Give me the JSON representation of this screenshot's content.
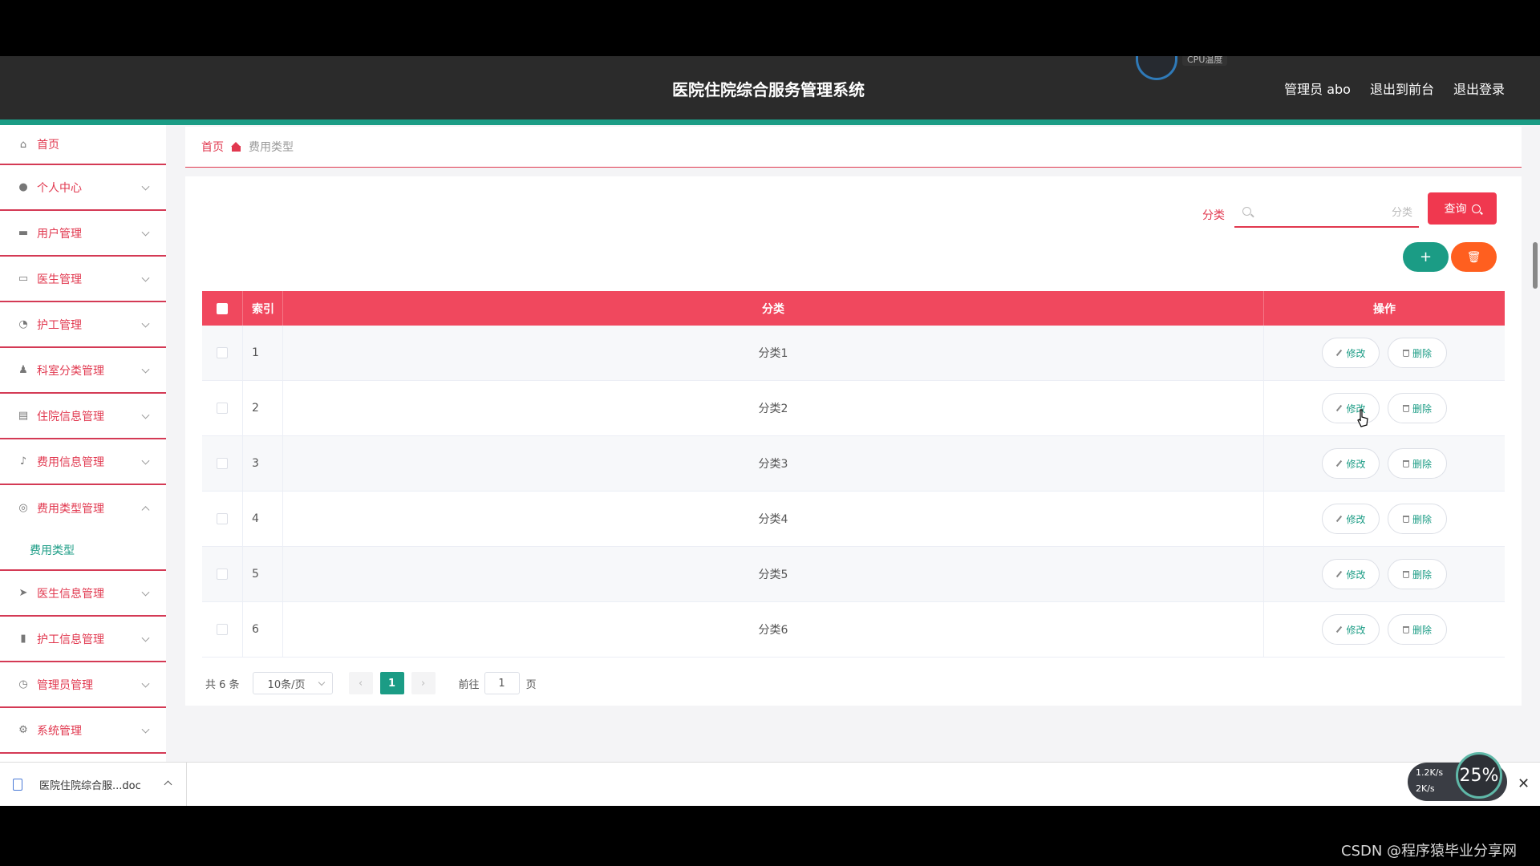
{
  "header": {
    "title": "医院住院综合服务管理系统",
    "cpu_label": "CPU温度",
    "links": [
      "管理员 abo",
      "退出到前台",
      "退出登录"
    ]
  },
  "sidebar": {
    "items": [
      {
        "label": "首页",
        "icon": "home-icon"
      },
      {
        "label": "个人中心",
        "icon": "user-icon"
      },
      {
        "label": "用户管理",
        "icon": "users-icon"
      },
      {
        "label": "医生管理",
        "icon": "monitor-icon"
      },
      {
        "label": "护工管理",
        "icon": "gauge-icon"
      },
      {
        "label": "科室分类管理",
        "icon": "person-icon"
      },
      {
        "label": "住院信息管理",
        "icon": "chat-icon"
      },
      {
        "label": "费用信息管理",
        "icon": "mic-icon"
      },
      {
        "label": "费用类型管理",
        "icon": "globe-icon",
        "open": true,
        "sub": "费用类型"
      },
      {
        "label": "医生信息管理",
        "icon": "send-icon"
      },
      {
        "label": "护工信息管理",
        "icon": "bar-chart-icon"
      },
      {
        "label": "管理员管理",
        "icon": "clock-icon"
      },
      {
        "label": "系统管理",
        "icon": "settings-icon"
      }
    ]
  },
  "breadcrumb": {
    "home": "首页",
    "current": "费用类型"
  },
  "search": {
    "label": "分类",
    "placeholder": "分类",
    "button": "查询"
  },
  "toolbar": {
    "add": "+"
  },
  "table": {
    "headers": {
      "index": "索引",
      "category": "分类",
      "actions": "操作"
    },
    "edit_label": "修改",
    "delete_label": "删除",
    "rows": [
      {
        "index": "1",
        "category": "分类1"
      },
      {
        "index": "2",
        "category": "分类2"
      },
      {
        "index": "3",
        "category": "分类3"
      },
      {
        "index": "4",
        "category": "分类4"
      },
      {
        "index": "5",
        "category": "分类5"
      },
      {
        "index": "6",
        "category": "分类6"
      }
    ]
  },
  "pagination": {
    "total": "共 6 条",
    "page_size": "10条/页",
    "current_page": "1",
    "goto_label": "前往",
    "goto_value": "1",
    "page_suffix": "页"
  },
  "download_bar": {
    "filename": "医院住院综合服...doc"
  },
  "net_widget": {
    "up": "1.2K/s",
    "down": "2K/s",
    "cpu": "25%"
  },
  "watermark": "CSDN @程序猿毕业分享网",
  "colors": {
    "primary": "#f0485e",
    "accent": "#1b9c85",
    "danger": "#ff5f1f",
    "header_bg": "#2b2b2b"
  }
}
